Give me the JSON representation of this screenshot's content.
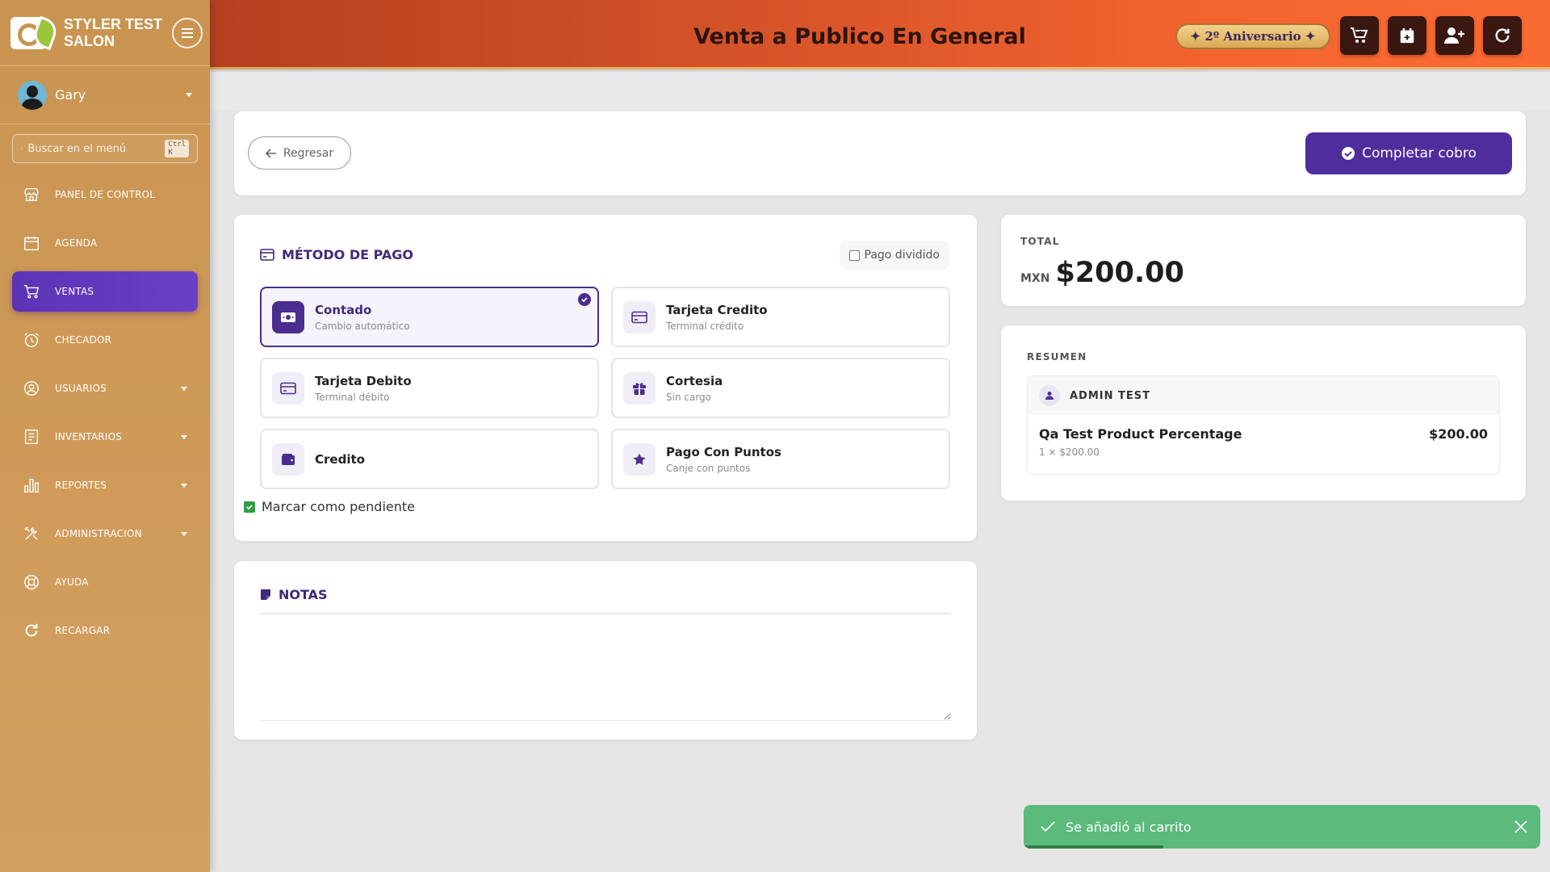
{
  "brand": {
    "name": "STYLER TEST SALON"
  },
  "user": {
    "name": "Gary"
  },
  "menu_search": {
    "placeholder": "Buscar en el menú",
    "shortcut": "Ctrl K"
  },
  "nav": [
    {
      "label": "PANEL DE CONTROL",
      "icon": "store-icon",
      "has_submenu": false,
      "active": false
    },
    {
      "label": "AGENDA",
      "icon": "calendar-icon",
      "has_submenu": false,
      "active": false
    },
    {
      "label": "VENTAS",
      "icon": "cart-icon",
      "has_submenu": false,
      "active": true
    },
    {
      "label": "CHECADOR",
      "icon": "alarm-clock-icon",
      "has_submenu": false,
      "active": false
    },
    {
      "label": "USUARIOS",
      "icon": "user-circle-icon",
      "has_submenu": true,
      "active": false
    },
    {
      "label": "INVENTARIOS",
      "icon": "list-icon",
      "has_submenu": true,
      "active": false
    },
    {
      "label": "REPORTES",
      "icon": "bar-chart-icon",
      "has_submenu": true,
      "active": false
    },
    {
      "label": "ADMINISTRACION",
      "icon": "tools-icon",
      "has_submenu": true,
      "active": false
    },
    {
      "label": "AYUDA",
      "icon": "lifebuoy-icon",
      "has_submenu": false,
      "active": false
    },
    {
      "label": "RECARGAR",
      "icon": "reload-icon",
      "has_submenu": false,
      "active": false
    }
  ],
  "header": {
    "title": "Venta a Publico En General",
    "anniversary": "✦ 2º Aniversario ✦",
    "buttons": [
      "cart-plus-icon",
      "calendar-plus-icon",
      "user-plus-icon",
      "refresh-icon"
    ]
  },
  "actions": {
    "back_label": "Regresar",
    "complete_label": "Completar cobro"
  },
  "payment": {
    "title": "MÉTODO DE PAGO",
    "split_label": "Pago dividido",
    "options": [
      {
        "title": "Contado",
        "subtitle": "Cambio automático",
        "icon": "cash-icon",
        "selected": true
      },
      {
        "title": "Tarjeta Credito",
        "subtitle": "Terminal crédito",
        "icon": "credit-card-icon",
        "selected": false
      },
      {
        "title": "Tarjeta Debito",
        "subtitle": "Terminal débito",
        "icon": "debit-card-icon",
        "selected": false
      },
      {
        "title": "Cortesia",
        "subtitle": "Sin cargo",
        "icon": "gift-icon",
        "selected": false
      },
      {
        "title": "Credito",
        "subtitle": "",
        "icon": "wallet-icon",
        "selected": false
      },
      {
        "title": "Pago Con Puntos",
        "subtitle": "Canje con puntos",
        "icon": "star-icon",
        "selected": false
      }
    ],
    "pending_label": "Marcar como pendiente",
    "pending_checked": true
  },
  "notes": {
    "title": "NOTAS",
    "value": ""
  },
  "total": {
    "label": "TOTAL",
    "currency": "MXN",
    "amount": "$200.00"
  },
  "summary": {
    "title": "RESUMEN",
    "client": "ADMIN TEST",
    "items": [
      {
        "name": "Qa Test Product Percentage",
        "detail": "1 × $200.00",
        "price": "$200.00"
      }
    ]
  },
  "toast": {
    "message": "Se añadió al carrito",
    "progress": 0.27
  },
  "colors": {
    "accent": "#4f2d9c",
    "sidebar": "#c99450",
    "header": "#f4642f",
    "success": "#5cba7d"
  }
}
